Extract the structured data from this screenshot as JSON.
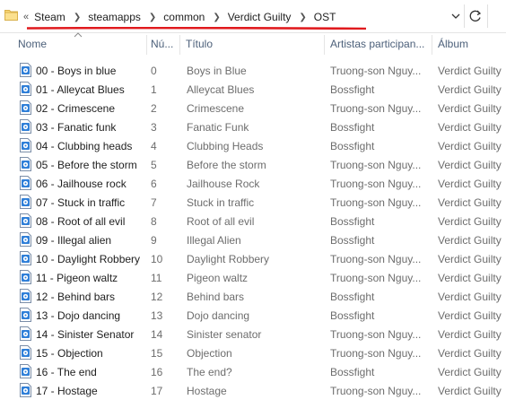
{
  "address_bar": {
    "overflow": "«",
    "crumbs": [
      "Steam",
      "steamapps",
      "common",
      "Verdict Guilty",
      "OST"
    ],
    "annotation_color": "#e0191d"
  },
  "columns": {
    "name": "Nome",
    "number": "Nú...",
    "title": "Título",
    "artists": "Artistas participan...",
    "album": "Álbum"
  },
  "files": [
    {
      "name": "00 - Boys in blue",
      "number": "0",
      "title": "Boys in Blue",
      "artist": "Truong-son Nguy...",
      "album": "Verdict Guilty"
    },
    {
      "name": "01 - Alleycat Blues",
      "number": "1",
      "title": "Alleycat Blues",
      "artist": "Bossfight",
      "album": "Verdict Guilty"
    },
    {
      "name": "02 - Crimescene",
      "number": "2",
      "title": "Crimescene",
      "artist": "Truong-son Nguy...",
      "album": "Verdict Guilty"
    },
    {
      "name": "03 - Fanatic funk",
      "number": "3",
      "title": "Fanatic Funk",
      "artist": "Bossfight",
      "album": "Verdict Guilty"
    },
    {
      "name": "04 - Clubbing heads",
      "number": "4",
      "title": "Clubbing Heads",
      "artist": "Bossfight",
      "album": "Verdict Guilty"
    },
    {
      "name": "05 - Before the storm",
      "number": "5",
      "title": "Before the storm",
      "artist": "Truong-son Nguy...",
      "album": "Verdict Guilty"
    },
    {
      "name": "06 - Jailhouse rock",
      "number": "6",
      "title": "Jailhouse Rock",
      "artist": "Truong-son Nguy...",
      "album": "Verdict Guilty"
    },
    {
      "name": "07 - Stuck in traffic",
      "number": "7",
      "title": "Stuck in traffic",
      "artist": "Truong-son Nguy...",
      "album": "Verdict Guilty"
    },
    {
      "name": "08 - Root of all evil",
      "number": "8",
      "title": "Root of all evil",
      "artist": "Bossfight",
      "album": "Verdict Guilty"
    },
    {
      "name": "09 - Illegal alien",
      "number": "9",
      "title": "Illegal Alien",
      "artist": "Bossfight",
      "album": "Verdict Guilty"
    },
    {
      "name": "10 - Daylight Robbery",
      "number": "10",
      "title": "Daylight Robbery",
      "artist": "Truong-son Nguy...",
      "album": "Verdict Guilty"
    },
    {
      "name": "11 - Pigeon waltz",
      "number": "11",
      "title": "Pigeon waltz",
      "artist": "Truong-son Nguy...",
      "album": "Verdict Guilty"
    },
    {
      "name": "12 - Behind bars",
      "number": "12",
      "title": "Behind bars",
      "artist": "Bossfight",
      "album": "Verdict Guilty"
    },
    {
      "name": "13 - Dojo dancing",
      "number": "13",
      "title": "Dojo dancing",
      "artist": "Bossfight",
      "album": "Verdict Guilty"
    },
    {
      "name": "14 - Sinister Senator",
      "number": "14",
      "title": "Sinister senator",
      "artist": "Truong-son Nguy...",
      "album": "Verdict Guilty"
    },
    {
      "name": "15 - Objection",
      "number": "15",
      "title": "Objection",
      "artist": "Truong-son Nguy...",
      "album": "Verdict Guilty"
    },
    {
      "name": "16 - The end",
      "number": "16",
      "title": "The end?",
      "artist": "Bossfight",
      "album": "Verdict Guilty"
    },
    {
      "name": "17 - Hostage",
      "number": "17",
      "title": "Hostage",
      "artist": "Truong-son Nguy...",
      "album": "Verdict Guilty"
    }
  ]
}
